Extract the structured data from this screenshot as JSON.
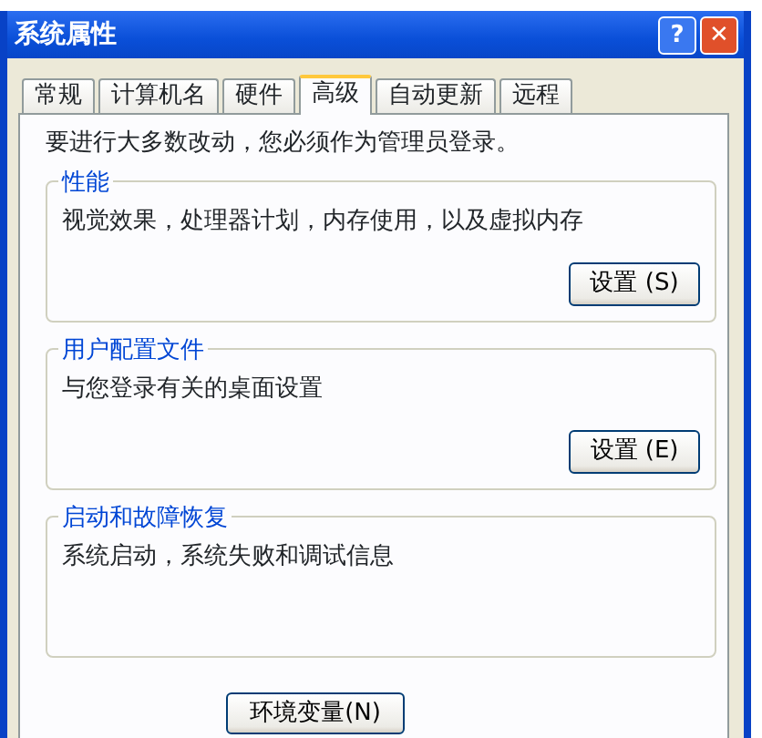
{
  "window": {
    "title": "系统属性",
    "buttons": [
      {
        "kind": "help",
        "label": "?"
      },
      {
        "kind": "close",
        "label": "✕"
      }
    ]
  },
  "tabs": [
    {
      "label": "常规",
      "selected": false
    },
    {
      "label": "计算机名",
      "selected": false
    },
    {
      "label": "硬件",
      "selected": false
    },
    {
      "label": "高级",
      "selected": true
    },
    {
      "label": "自动更新",
      "selected": false
    },
    {
      "label": "远程",
      "selected": false
    }
  ],
  "note": "要进行大多数改动，您必须作为管理员登录。",
  "groups": [
    {
      "title": "性能",
      "text": "视觉效果，处理器计划，内存使用，以及虚拟内存",
      "button": "设置 (S)"
    },
    {
      "title": "用户配置文件",
      "text": "与您登录有关的桌面设置",
      "button": "设置 (E)"
    },
    {
      "title": "启动和故障恢复",
      "text": "系统启动，系统失败和调试信息"
    }
  ],
  "bottom_buttons": [
    "环境变量(N)"
  ]
}
